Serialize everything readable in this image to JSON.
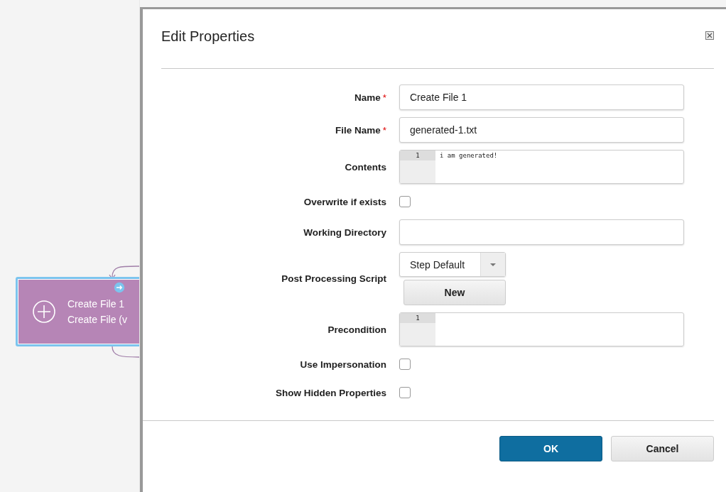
{
  "canvas": {
    "node": {
      "title": "Create File 1",
      "subtitle": "Create File (v",
      "selected": true
    }
  },
  "dialog": {
    "title": "Edit Properties",
    "fields": [
      {
        "kind": "text",
        "label": "Name",
        "required_mark": "*",
        "value": "Create File 1"
      },
      {
        "kind": "text",
        "label": "File Name",
        "required_mark": "*",
        "value": "generated-1.txt"
      },
      {
        "kind": "code",
        "label": "Contents",
        "lines": [
          {
            "number": "1",
            "text": "i am generated!"
          }
        ]
      },
      {
        "kind": "checkbox",
        "label": "Overwrite if exists",
        "checked": false
      },
      {
        "kind": "text",
        "label": "Working Directory"
      },
      {
        "kind": "select",
        "label": "Post Processing Script",
        "value": "Step Default",
        "button": "New"
      },
      {
        "kind": "code",
        "label": "Precondition",
        "lines": [
          {
            "number": "1"
          }
        ]
      },
      {
        "kind": "checkbox",
        "label": "Use Impersonation",
        "checked": false
      },
      {
        "kind": "checkbox",
        "label": "Show Hidden Properties",
        "checked": false
      }
    ],
    "buttons": [
      {
        "label": "OK",
        "kind": "primary"
      },
      {
        "label": "Cancel",
        "kind": "secondary"
      }
    ]
  }
}
